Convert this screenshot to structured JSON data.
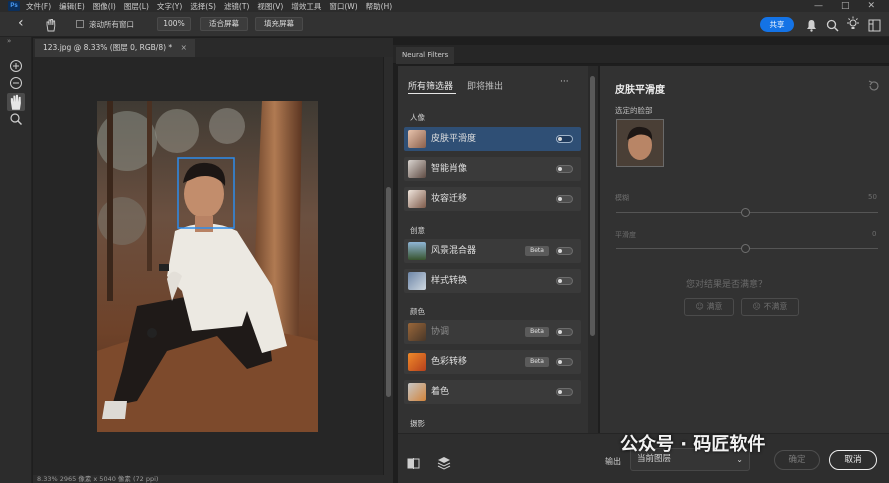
{
  "menubar": {
    "logo": "Ps",
    "items": [
      "文件(F)",
      "编辑(E)",
      "图像(I)",
      "图层(L)",
      "文字(Y)",
      "选择(S)",
      "滤镜(T)",
      "视图(V)",
      "增效工具",
      "窗口(W)",
      "帮助(H)"
    ],
    "minimize": "—",
    "maximize": "□",
    "close": "✕"
  },
  "optionsbar": {
    "back_icon": "‹",
    "hand_icon": "hand-icon",
    "scroll_all_label": "滚动所有窗口",
    "zoom_label": "100%",
    "fit_screen_label": "适合屏幕",
    "fill_screen_label": "填充屏幕",
    "share_label": "共享"
  },
  "document": {
    "tab_title": "123.jpg @ 8.33% (图层 0, RGB/8) *",
    "tab_close": "×",
    "status": "8.33%    2965 像素 x 5040 像素 (72 ppi)"
  },
  "neural_filters": {
    "panel_title": "Neural Filters",
    "tabs": [
      "所有筛选器",
      "即将推出"
    ],
    "more_label": "···",
    "sections": [
      {
        "label": "人像",
        "filters": [
          {
            "name": "皮肤平滑度",
            "active": true
          },
          {
            "name": "智能肖像"
          },
          {
            "name": "妆容迁移"
          }
        ]
      },
      {
        "label": "创意",
        "filters": [
          {
            "name": "风景混合器",
            "beta": "Beta"
          },
          {
            "name": "样式转换"
          }
        ]
      },
      {
        "label": "颜色",
        "filters": [
          {
            "name": "协调",
            "beta": "Beta",
            "dim": true
          },
          {
            "name": "色彩转移",
            "beta": "Beta"
          },
          {
            "name": "着色"
          }
        ]
      },
      {
        "label": "摄影",
        "filters": []
      }
    ]
  },
  "detail": {
    "title": "皮肤平滑度",
    "selected_face_label": "选定的脸部",
    "blur_label": "模糊",
    "blur_value": "50",
    "smooth_label": "平滑度",
    "smooth_value": "0",
    "feedback_question": "您对结果是否满意？",
    "satisfied_label": "满意",
    "unsatisfied_label": "不满意"
  },
  "bottom": {
    "output_label": "输出",
    "output_value": "当前图层",
    "ok_label": "确定",
    "cancel_label": "取消"
  },
  "watermark": "公众号 · 码匠软件"
}
